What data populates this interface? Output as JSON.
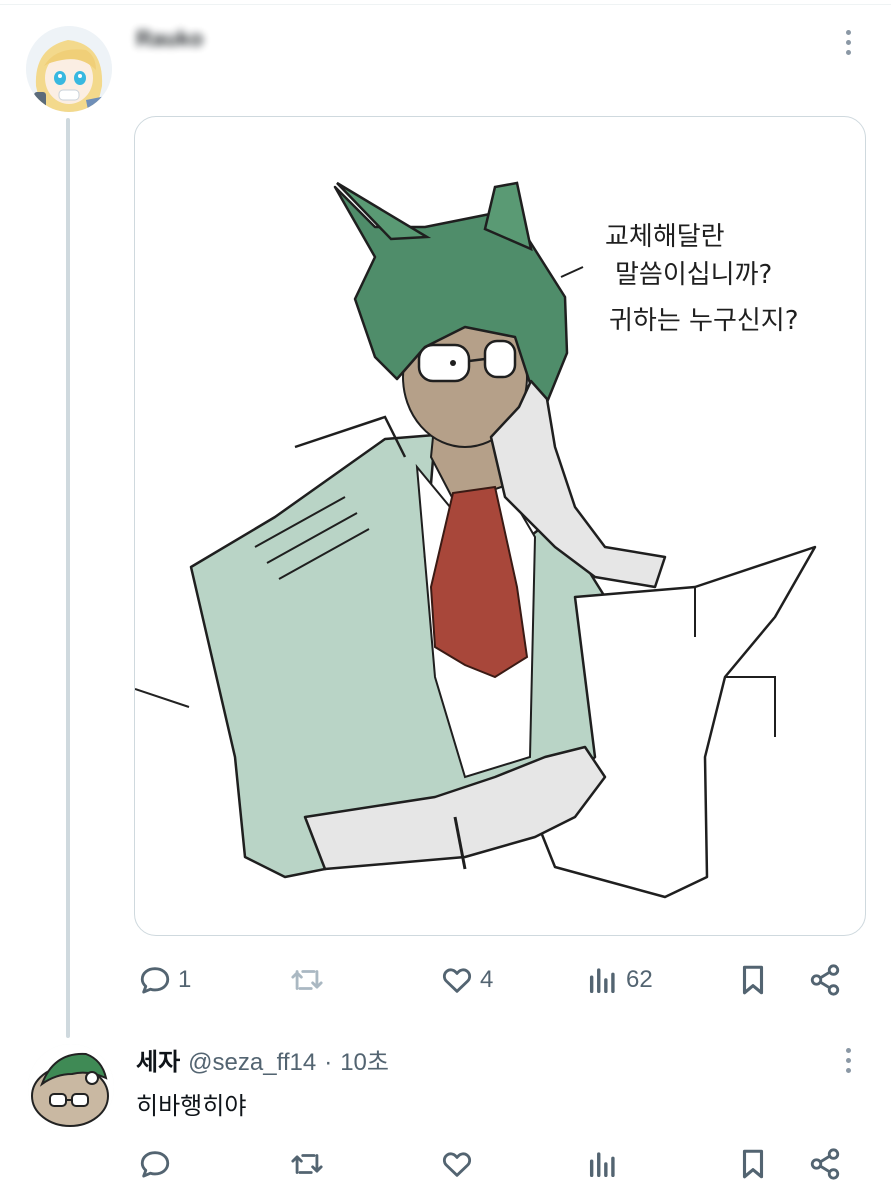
{
  "tweet": {
    "author_name": "Rauko",
    "media": {
      "speech_lines": [
        "교체해달란",
        "말씀이십니까?",
        "귀하는 누구신지?"
      ]
    },
    "stats": {
      "reply_count": "1",
      "like_count": "4",
      "view_count": "62"
    }
  },
  "reply": {
    "name": "세자",
    "handle": "@seza_ff14",
    "separator": "·",
    "time": "10초",
    "text": "히바행히야"
  },
  "icons": {
    "reply": "speech-bubble-icon",
    "retweet": "retweet-icon",
    "like": "heart-icon",
    "views": "bar-chart-icon",
    "bookmark": "bookmark-icon",
    "share": "share-icon",
    "more": "more-vertical-icon"
  },
  "colors": {
    "icon_gray": "#536471",
    "border": "#cfd9de",
    "hair": "#4f8d6a",
    "coat": "#b9d4c6",
    "cravat": "#a8473a"
  }
}
